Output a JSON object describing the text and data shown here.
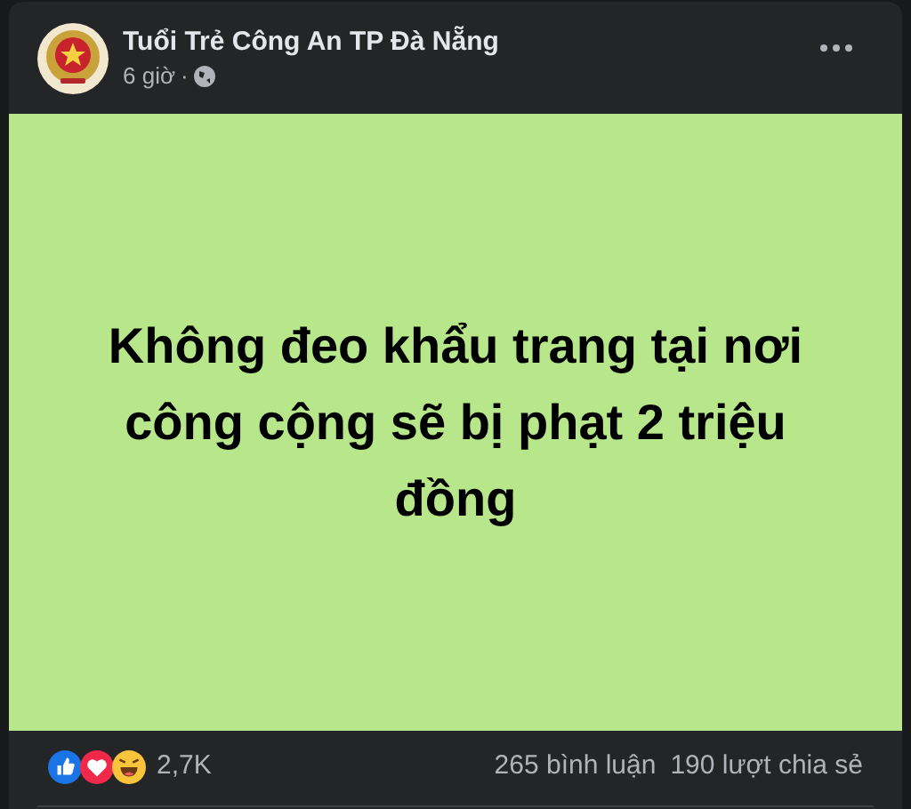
{
  "post": {
    "author": "Tuổi Trẻ Công An TP Đà Nẵng",
    "time": "6 giờ",
    "separator": "·"
  },
  "content": {
    "text": "Không đeo khẩu trang tại nơi công cộng sẽ bị phạt 2 triệu đồng"
  },
  "footer": {
    "reactions_count": "2,7K",
    "comments": "265 bình luận",
    "shares": "190 lượt chia sẻ"
  }
}
